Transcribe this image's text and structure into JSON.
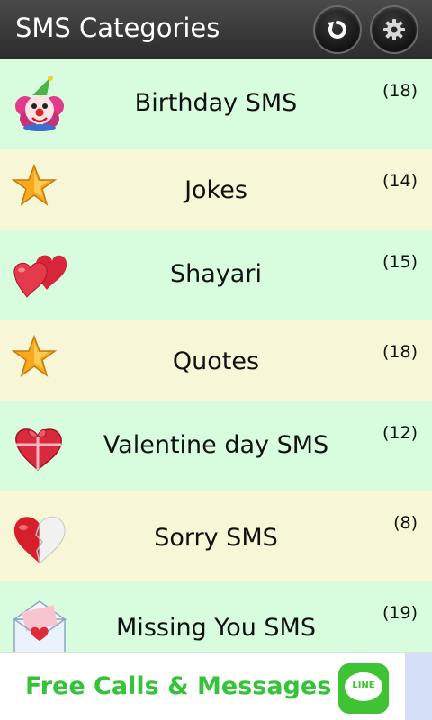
{
  "header": {
    "title": "SMS Categories",
    "refresh_icon": "refresh-icon",
    "settings_icon": "gear-icon"
  },
  "colors": {
    "header_bg": "#333333",
    "row_green": "#d7fcde",
    "row_cream": "#f7f6d6",
    "ad_text": "#35c33a"
  },
  "categories": [
    {
      "label": "Birthday SMS",
      "count": "(18)",
      "icon": "clown-icon"
    },
    {
      "label": "Jokes",
      "count": "(14)",
      "icon": "star-icon"
    },
    {
      "label": "Shayari",
      "count": "(15)",
      "icon": "hearts-icon"
    },
    {
      "label": "Quotes",
      "count": "(18)",
      "icon": "star-icon"
    },
    {
      "label": "Valentine day SMS",
      "count": "(12)",
      "icon": "heart-gift-icon"
    },
    {
      "label": "Sorry SMS",
      "count": "(8)",
      "icon": "broken-heart-icon"
    },
    {
      "label": "Missing You SMS",
      "count": "(19)",
      "icon": "love-letter-icon"
    }
  ],
  "ad": {
    "text": "Free Calls & Messages",
    "logo_text": "LINE",
    "logo_icon": "line-logo-icon"
  }
}
